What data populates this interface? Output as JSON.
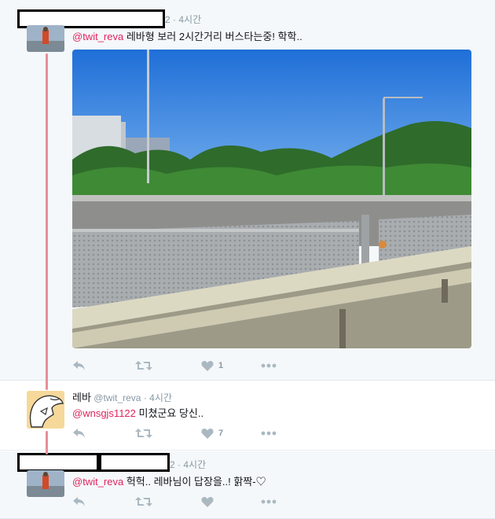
{
  "colors": {
    "mention": "#e0245e",
    "thread_line": "#e88e9b",
    "icon": "#aab8c2"
  },
  "tweets": [
    {
      "handle_suffix": "2",
      "time": "· 4시간",
      "mention": "@twit_reva",
      "text": " 레바형 보러 2시간거리 버스타는중! 학학..",
      "like_count": "1"
    },
    {
      "display_name": "레바",
      "handle": "@twit_reva",
      "time": "· 4시간",
      "mention": "@wnsgjs1122",
      "text": " 미쳤군요 당신..",
      "like_count": "7"
    },
    {
      "handle_suffix": "2",
      "time": "· 4시간",
      "mention": "@twit_reva",
      "text": " 헉헉.. 레바님이 답장을..! 핡짝-♡",
      "like_count": ""
    }
  ],
  "icons": [
    "reply-icon",
    "retweet-icon",
    "like-icon",
    "more-icon"
  ]
}
